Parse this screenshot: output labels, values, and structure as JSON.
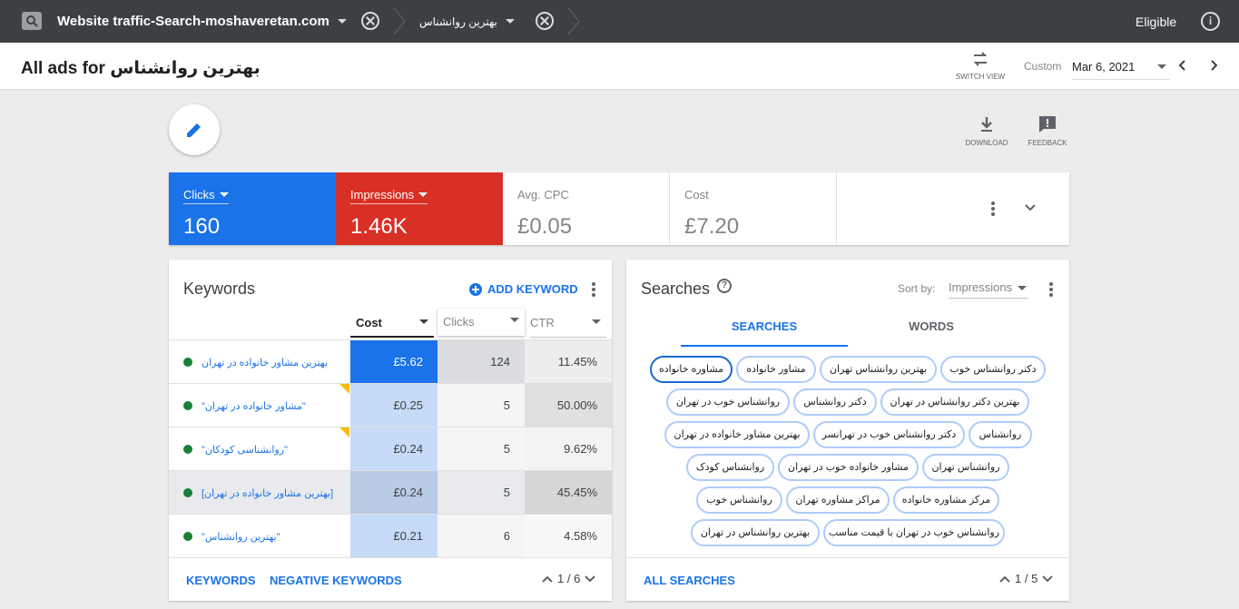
{
  "topbar": {
    "account": "Website traffic-Search-moshaveretan.com",
    "adgroup": "بهترین روانشناس",
    "status": "Eligible",
    "info_icon": "i"
  },
  "header": {
    "title": "All ads for بهترین روانشناس",
    "switch_view": "SWITCH VIEW",
    "range_label": "Custom",
    "date": "Mar 6, 2021"
  },
  "actions": {
    "download": "DOWNLOAD",
    "feedback": "FEEDBACK"
  },
  "metrics": [
    {
      "label": "Clicks",
      "value": "160",
      "color": "#1a73e8"
    },
    {
      "label": "Impressions",
      "value": "1.46K",
      "color": "#d93025"
    },
    {
      "label": "Avg. CPC",
      "value": "£0.05"
    },
    {
      "label": "Cost",
      "value": "£7.20"
    }
  ],
  "keywords": {
    "title": "Keywords",
    "add_label": "ADD KEYWORD",
    "columns": [
      "Cost",
      "Clicks",
      "CTR"
    ],
    "rows": [
      {
        "keyword": "بهترین مشاور خانواده در تهران",
        "cost": "£5.62",
        "clicks": "124",
        "ctr": "11.45%"
      },
      {
        "keyword": "\"مشاور خانواده در تهران\"",
        "cost": "£0.25",
        "clicks": "5",
        "ctr": "50.00%"
      },
      {
        "keyword": "\"روانشناسی کودکان\"",
        "cost": "£0.24",
        "clicks": "5",
        "ctr": "9.62%"
      },
      {
        "keyword": "[بهترین مشاور خانواده در تهران]",
        "cost": "£0.24",
        "clicks": "5",
        "ctr": "45.45%"
      },
      {
        "keyword": "\"بهترین روانشناس\"",
        "cost": "£0.21",
        "clicks": "6",
        "ctr": "4.58%"
      }
    ],
    "footer": {
      "keywords_link": "KEYWORDS",
      "negative_link": "NEGATIVE KEYWORDS",
      "page": "1 / 6"
    }
  },
  "searches": {
    "title": "Searches",
    "help_icon": "?",
    "sort_label": "Sort by:",
    "sort_value": "Impressions",
    "tabs": [
      "SEARCHES",
      "WORDS"
    ],
    "chips": [
      "دکتر روانشناس خوب",
      "بهترین روانشناس تهران",
      "مشاور خانواده",
      "مشاوره خانواده",
      "بهترین دکتر روانشناس در تهران",
      "دکتر روانشناس",
      "روانشناس خوب در تهران",
      "روانشناس",
      "دکتر روانشناس خوب در تهرانسر",
      "بهترین مشاور خانواده در تهران",
      "روانشناس تهران",
      "مشاور خانواده خوب در تهران",
      "روانشناس کودک",
      "مرکز مشاوره خانواده",
      "مراکز مشاوره تهران",
      "روانشناس خوب",
      "روانشناس خوب در تهران با قیمت مناسب",
      "بهترین روانشناس در تهران"
    ],
    "footer": {
      "all_link": "ALL SEARCHES",
      "page": "1 / 5"
    }
  }
}
